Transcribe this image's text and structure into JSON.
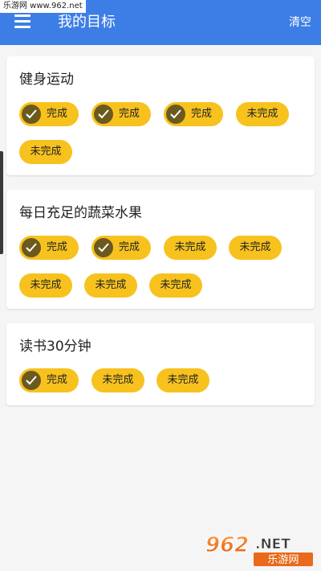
{
  "watermark": {
    "text": "乐游网 www.962.net"
  },
  "appbar": {
    "title": "我的目标",
    "clear_label": "清空",
    "color": "#3d7ee6"
  },
  "goals": [
    {
      "title": "健身运动",
      "status": [
        "完成",
        "完成",
        "完成",
        "未完成",
        "未完成"
      ]
    },
    {
      "title": "每日充足的蔬菜水果",
      "status": [
        "完成",
        "完成",
        "未完成",
        "未完成",
        "未完成",
        "未完成",
        "未完成"
      ]
    },
    {
      "title": "读书30分钟",
      "status": [
        "完成",
        "未完成",
        "未完成"
      ]
    }
  ],
  "chip_color": "#f7c21e",
  "check_color": "#6b5a1e",
  "logo": {
    "brand": "962.NET",
    "name": "乐游网"
  }
}
